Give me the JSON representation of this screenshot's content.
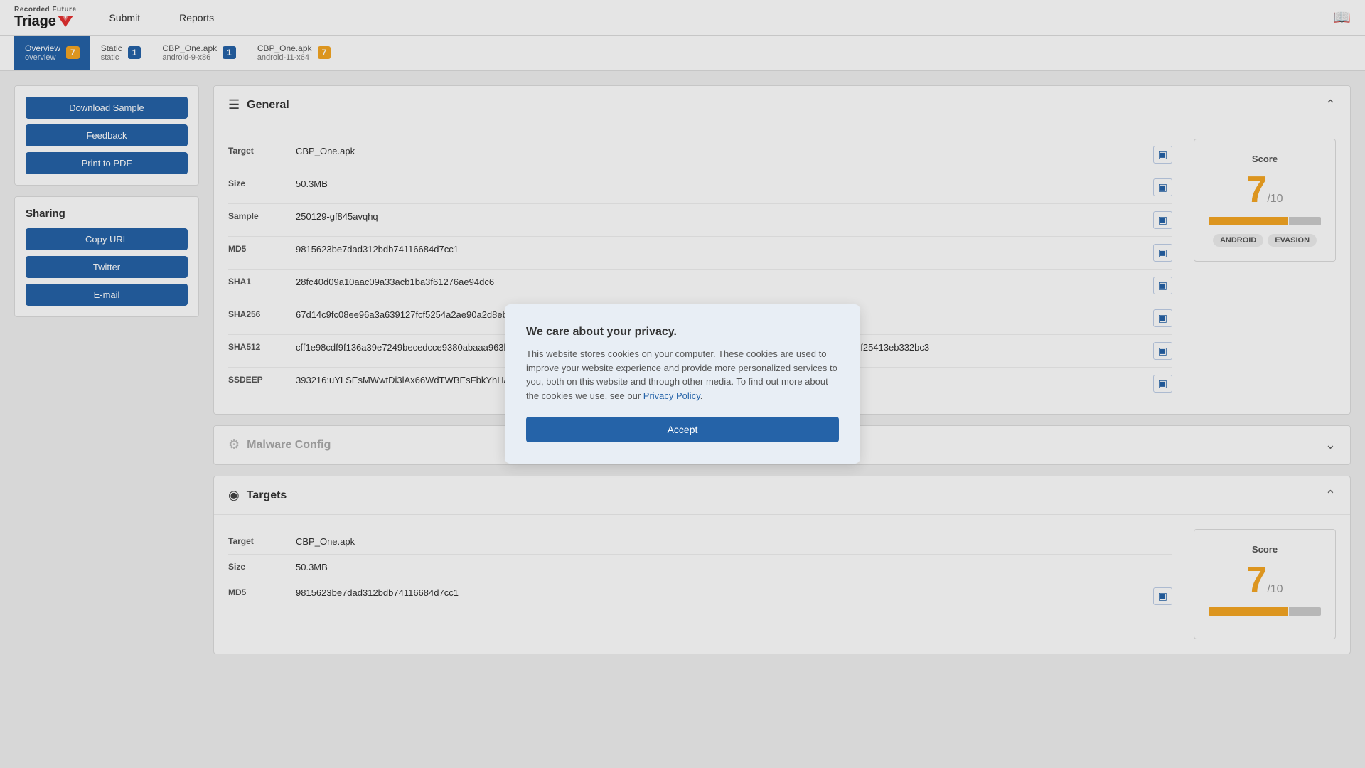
{
  "header": {
    "logo_brand": "Recorded Future",
    "logo_product": "Triage",
    "nav": [
      {
        "label": "Submit",
        "id": "submit"
      },
      {
        "label": "Reports",
        "id": "reports"
      }
    ],
    "book_icon": "📖"
  },
  "tabs": [
    {
      "id": "overview",
      "label": "Overview",
      "sublabel": "overview",
      "badge": "7",
      "active": true
    },
    {
      "id": "static",
      "label": "Static",
      "sublabel": "static",
      "badge": "1",
      "active": false
    },
    {
      "id": "cbp_android",
      "label": "CBP_One.apk",
      "sublabel": "android-9-x86",
      "badge": "1",
      "active": false
    },
    {
      "id": "cbp_android11",
      "label": "CBP_One.apk",
      "sublabel": "android-11-x64",
      "badge": "7",
      "active": false
    }
  ],
  "sidebar": {
    "actions": [
      {
        "label": "Download Sample",
        "id": "download-sample"
      },
      {
        "label": "Feedback",
        "id": "feedback"
      },
      {
        "label": "Print to PDF",
        "id": "print-pdf"
      }
    ],
    "sharing": {
      "title": "Sharing",
      "buttons": [
        {
          "label": "Copy URL",
          "id": "copy-url"
        },
        {
          "label": "Twitter",
          "id": "twitter"
        },
        {
          "label": "E-mail",
          "id": "email"
        }
      ]
    }
  },
  "general": {
    "section_title": "General",
    "fields": [
      {
        "key": "Target",
        "value": "CBP_One.apk"
      },
      {
        "key": "Size",
        "value": "50.3MB"
      },
      {
        "key": "Sample",
        "value": "250129-gf845avqhq"
      },
      {
        "key": "MD5",
        "value": "9815623be7dad312bdb74116684d7cc1"
      },
      {
        "key": "SHA1",
        "value": "28fc40d09a10aac09a33acb1ba3f61276ae94dc6"
      },
      {
        "key": "SHA256",
        "value": "67d14c9fc08ee96a3a639127fcf5254a2ae90a2d8eb4f27623eafac247318134"
      },
      {
        "key": "SHA512",
        "value": "cff1e98cdf9f136a39e7249becedcce9380abaaa963b9b8a0632c5ed3c01e8845acadc9634ae8017286227b1ce4468636b8f8190d231ef62c6f25413eb332bc3"
      },
      {
        "key": "SSDEEP",
        "value": "393216:uYLSEsMWwtDi3lAx66WdTWBEsFbkYhH/47xX29qow2qesauyHymlzXVnDMQ1hSHO:uYLlsMFtDM16ABEHXAwqFIXCCRv"
      }
    ],
    "score": {
      "label": "Score",
      "value": "7",
      "denom": "/10",
      "bar_pct": 70,
      "tags": [
        "ANDROID",
        "EVASION"
      ]
    }
  },
  "malware_config": {
    "section_title": "Malware Config"
  },
  "targets": {
    "section_title": "Targets",
    "fields": [
      {
        "key": "Target",
        "value": "CBP_One.apk"
      },
      {
        "key": "Size",
        "value": "50.3MB"
      },
      {
        "key": "MD5",
        "value": "9815623be7dad312bdb74116684d7cc1"
      }
    ],
    "score": {
      "label": "Score",
      "value": "7",
      "denom": "/10",
      "bar_pct": 70
    }
  },
  "cookie_banner": {
    "title": "We care about your privacy.",
    "text": "This website stores cookies on your computer. These cookies are used to improve your website experience and provide more personalized services to you, both on this website and through other media. To find out more about the cookies we use, see our",
    "link_text": "Privacy Policy",
    "accept_label": "Accept"
  }
}
